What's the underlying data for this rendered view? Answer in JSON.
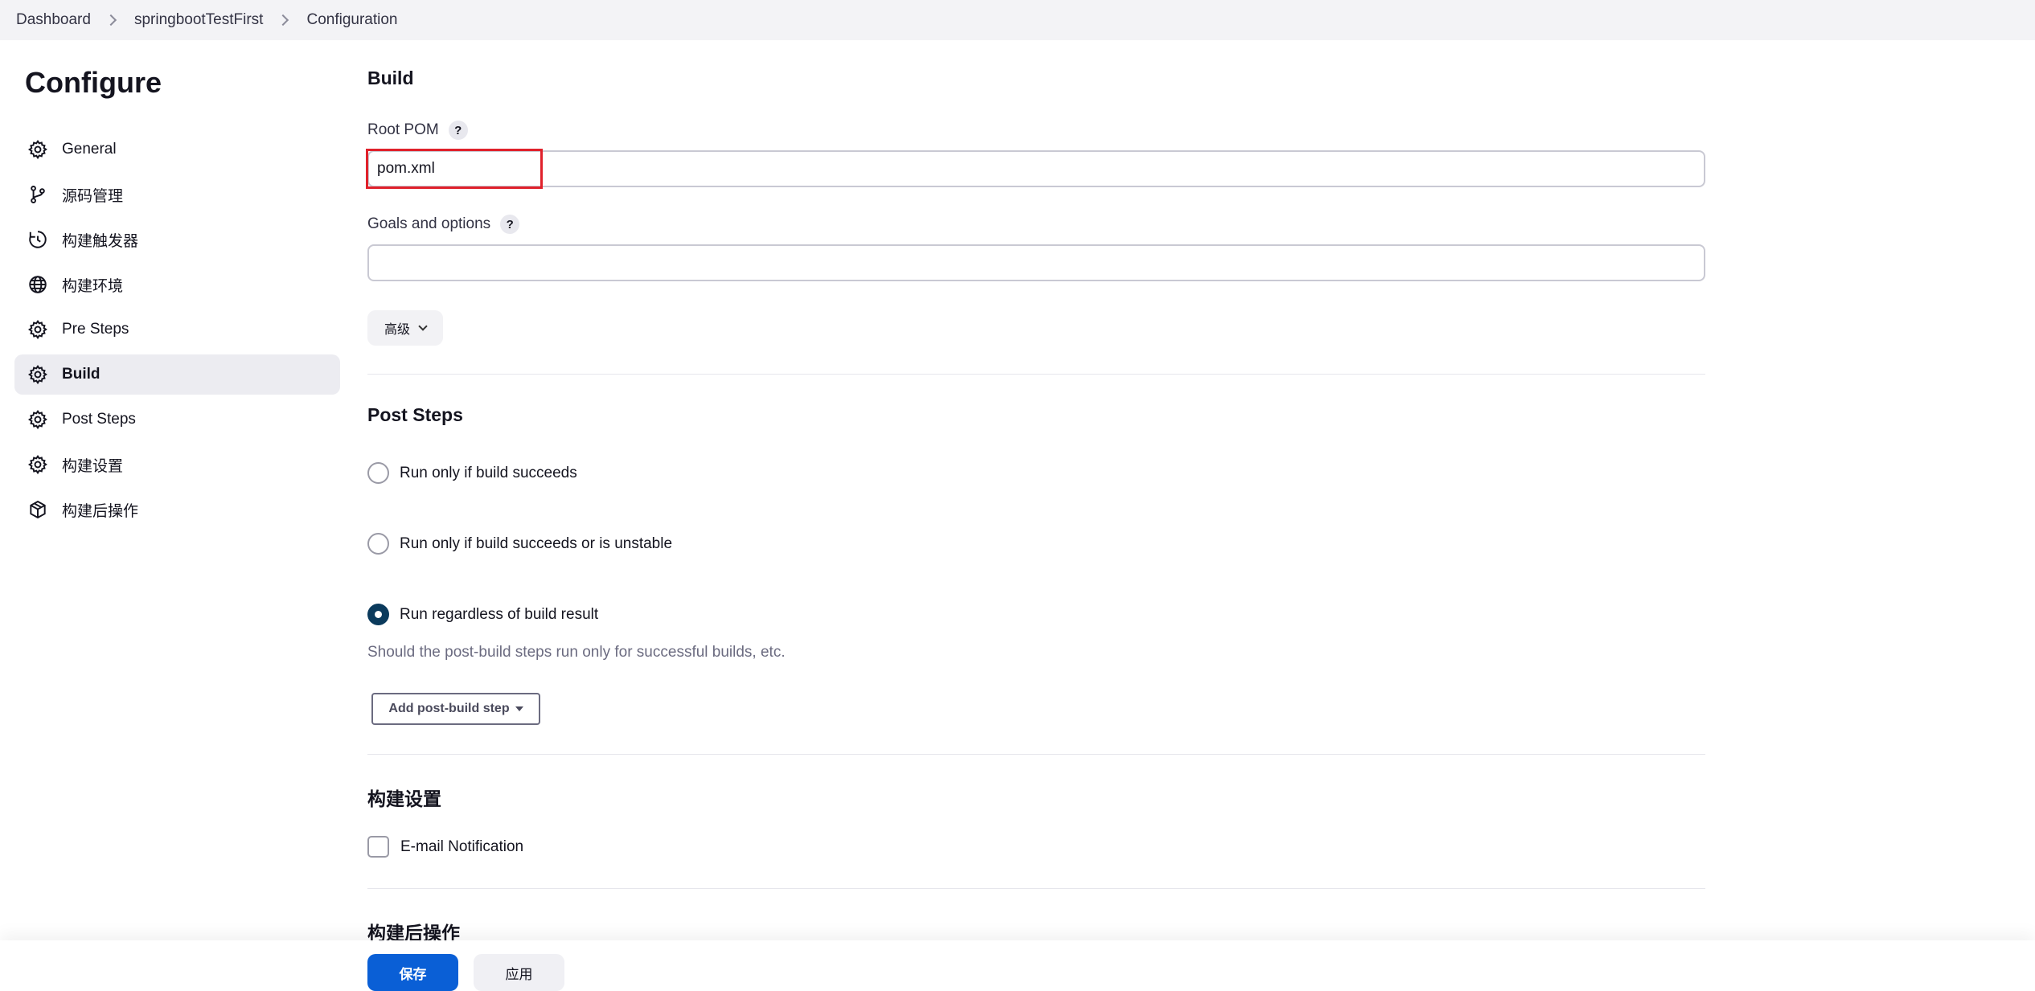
{
  "breadcrumb": {
    "items": [
      "Dashboard",
      "springbootTestFirst",
      "Configuration"
    ]
  },
  "page": {
    "title": "Configure"
  },
  "sidebar": {
    "items": [
      {
        "label": "General",
        "icon": "gear-icon"
      },
      {
        "label": "源码管理",
        "icon": "git-branch-icon"
      },
      {
        "label": "构建触发器",
        "icon": "clock-icon"
      },
      {
        "label": "构建环境",
        "icon": "globe-icon"
      },
      {
        "label": "Pre Steps",
        "icon": "gear-icon"
      },
      {
        "label": "Build",
        "icon": "gear-icon",
        "active": true
      },
      {
        "label": "Post Steps",
        "icon": "gear-icon"
      },
      {
        "label": "构建设置",
        "icon": "gear-icon"
      },
      {
        "label": "构建后操作",
        "icon": "cube-icon"
      }
    ]
  },
  "build": {
    "title": "Build",
    "root_pom_label": "Root POM",
    "root_pom_value": "pom.xml",
    "goals_label": "Goals and options",
    "goals_value": "",
    "help": "?",
    "advanced_label": "高级"
  },
  "post_steps": {
    "title": "Post Steps",
    "options": [
      {
        "label": "Run only if build succeeds",
        "checked": false
      },
      {
        "label": "Run only if build succeeds or is unstable",
        "checked": false
      },
      {
        "label": "Run regardless of build result",
        "checked": true
      }
    ],
    "helper": "Should the post-build steps run only for successful builds, etc.",
    "add_button": "Add post-build step"
  },
  "build_settings": {
    "title": "构建设置",
    "email_label": "E-mail Notification",
    "email_checked": false
  },
  "post_build": {
    "title": "构建后操作"
  },
  "footer": {
    "save_label": "保存",
    "apply_label": "应用"
  },
  "colors": {
    "primary": "#0a5fd6",
    "highlight": "#e0212b",
    "radio_checked": "#0b3a5c"
  }
}
